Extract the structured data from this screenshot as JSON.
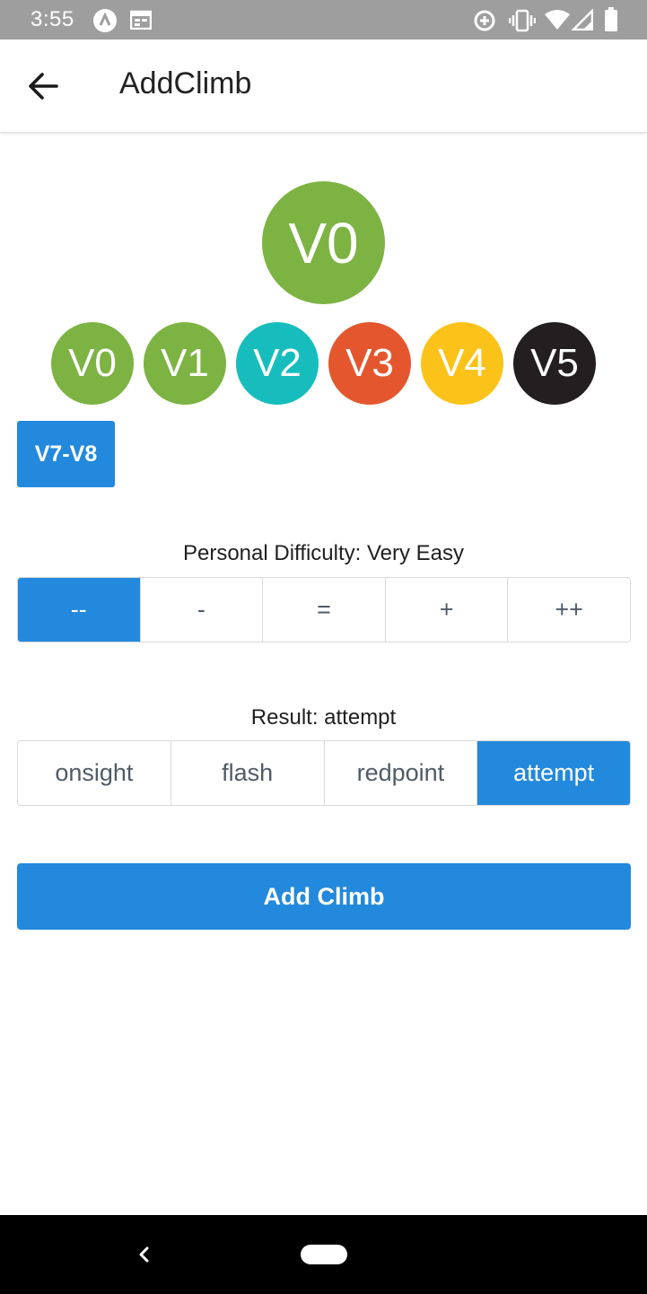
{
  "status_bar": {
    "time": "3:55",
    "icons_left": [
      "app-icon",
      "calendar-icon"
    ],
    "icons_right": [
      "data-saver-icon",
      "vibrate-icon",
      "wifi-icon",
      "signal-icon",
      "battery-icon"
    ]
  },
  "app_bar": {
    "title": "AddClimb",
    "back_icon": "arrow-left-icon"
  },
  "selected_grade": {
    "label": "V0",
    "color": "#7cb342"
  },
  "grades": [
    {
      "label": "V0",
      "color": "#7cb342"
    },
    {
      "label": "V1",
      "color": "#7cb342"
    },
    {
      "label": "V2",
      "color": "#17bdbd"
    },
    {
      "label": "V3",
      "color": "#e4572e"
    },
    {
      "label": "V4",
      "color": "#fbc319"
    },
    {
      "label": "V5",
      "color": "#231f20"
    }
  ],
  "range_button": {
    "label": "V7-V8"
  },
  "difficulty": {
    "label": "Personal Difficulty: Very Easy",
    "options": [
      "--",
      "-",
      "=",
      "+",
      "++"
    ],
    "selected_index": 0
  },
  "result": {
    "label": "Result: attempt",
    "options": [
      "onsight",
      "flash",
      "redpoint",
      "attempt"
    ],
    "selected_index": 3
  },
  "add_button": {
    "label": "Add Climb"
  },
  "colors": {
    "accent": "#2389dc",
    "status_bar": "#9e9e9e",
    "nav_bar": "#000000"
  }
}
